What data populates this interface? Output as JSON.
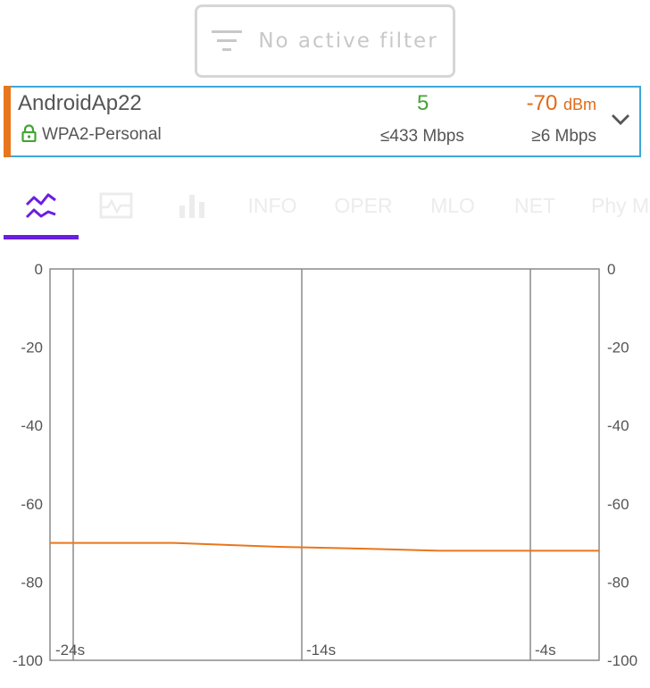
{
  "filter": {
    "label": "No active filter",
    "icon": "filter-icon"
  },
  "ap": {
    "ssid": "AndroidAp22",
    "security": "WPA2-Personal",
    "channel": "5",
    "signal_value": "-70",
    "signal_unit": "dBm",
    "max_rate": "≤433 Mbps",
    "min_rate": "≥6 Mbps",
    "accent_color": "#e8761d",
    "channel_color": "#43a535",
    "signal_color": "#e06a17"
  },
  "tabs": [
    {
      "id": "graph",
      "icon": "signal-graph-icon",
      "selected": true
    },
    {
      "id": "time",
      "icon": "timeline-icon"
    },
    {
      "id": "channels",
      "icon": "bar-chart-icon"
    },
    {
      "id": "info",
      "label": "INFO"
    },
    {
      "id": "oper",
      "label": "OPER"
    },
    {
      "id": "mlo",
      "label": "MLO"
    },
    {
      "id": "net",
      "label": "NET"
    },
    {
      "id": "phy",
      "label": "Phy M"
    }
  ],
  "chart_data": {
    "type": "line",
    "ylim": [
      -100,
      0
    ],
    "y_ticks": [
      "0",
      "-20",
      "-40",
      "-60",
      "-80",
      "-100"
    ],
    "y_tick_values": [
      0,
      -20,
      -40,
      -60,
      -80,
      -100
    ],
    "x_range": [
      -25,
      -1
    ],
    "x_markers": [
      {
        "x": -24,
        "label": "-24s"
      },
      {
        "x": -14,
        "label": "-14s"
      },
      {
        "x": -4,
        "label": "-4s"
      }
    ],
    "series": [
      {
        "color": "#e8761d",
        "x": [
          -25,
          -19.6,
          -15,
          -11,
          -8,
          -4,
          -1
        ],
        "y": [
          -70,
          -70,
          -71,
          -71.5,
          -72,
          -72,
          -72
        ]
      }
    ]
  }
}
